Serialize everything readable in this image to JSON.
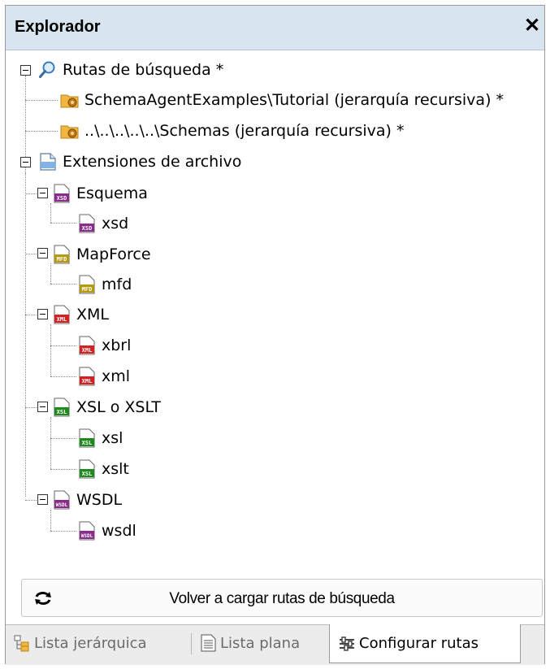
{
  "window": {
    "title": "Explorador",
    "close_label": "✕"
  },
  "tree": {
    "search_paths": {
      "label": "Rutas de búsqueda *",
      "children": [
        "SchemaAgentExamples\\Tutorial (jerarquía recursiva) *",
        "..\\..\\..\\..\\..\\Schemas (jerarquía recursiva) *"
      ]
    },
    "extensions": {
      "label": "Extensiones de archivo",
      "groups": [
        {
          "label": "Esquema",
          "badge": "XSD",
          "color": "#8a2a8a",
          "children": [
            "xsd"
          ]
        },
        {
          "label": "MapForce",
          "badge": "MFD",
          "color": "#b59a10",
          "children": [
            "mfd"
          ]
        },
        {
          "label": "XML",
          "badge": "XML",
          "color": "#d42020",
          "children": [
            "xbrl",
            "xml"
          ]
        },
        {
          "label": "XSL o XSLT",
          "badge": "XSL",
          "color": "#1e8a1e",
          "children": [
            "xsl",
            "xslt"
          ]
        },
        {
          "label": "WSDL",
          "badge": "WSDL",
          "color": "#8a2a8a",
          "children": [
            "wsdl"
          ]
        }
      ]
    }
  },
  "reload_button": {
    "label": "Volver a cargar rutas de búsqueda"
  },
  "tabs": [
    {
      "label": "Lista jerárquica",
      "icon": "hierarchy-icon",
      "active": false
    },
    {
      "label": "Lista plana",
      "icon": "flat-list-icon",
      "active": false
    },
    {
      "label": "Configurar rutas",
      "icon": "configure-paths-icon",
      "active": true
    }
  ],
  "colors": {
    "titlebar": "#d9e4f1",
    "folder": "#f0b840",
    "gear": "#c47a1a"
  }
}
